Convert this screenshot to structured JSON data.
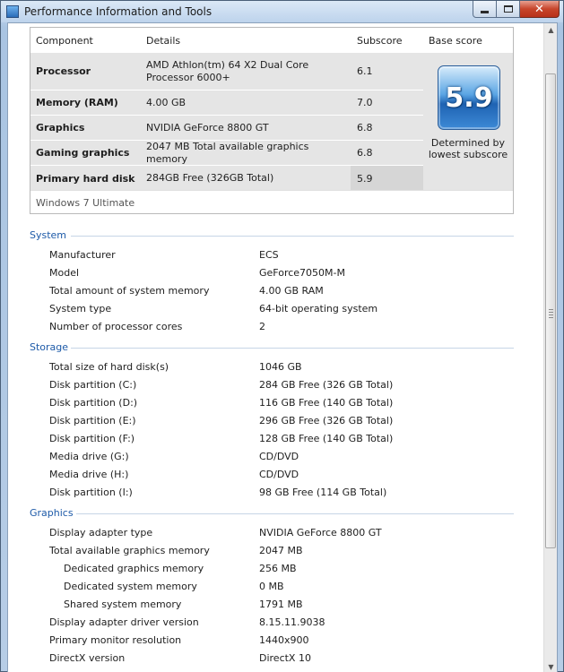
{
  "window": {
    "title": "Performance Information and Tools"
  },
  "scores": {
    "headers": {
      "component": "Component",
      "details": "Details",
      "subscore": "Subscore",
      "base": "Base score"
    },
    "rows": [
      {
        "component": "Processor",
        "details": "AMD Athlon(tm) 64 X2 Dual Core Processor 6000+",
        "subscore": "6.1"
      },
      {
        "component": "Memory (RAM)",
        "details": "4.00 GB",
        "subscore": "7.0"
      },
      {
        "component": "Graphics",
        "details": "NVIDIA GeForce 8800 GT",
        "subscore": "6.8"
      },
      {
        "component": "Gaming graphics",
        "details": "2047 MB Total available graphics memory",
        "subscore": "6.8"
      },
      {
        "component": "Primary hard disk",
        "details": "284GB Free (326GB Total)",
        "subscore": "5.9"
      }
    ],
    "base_score": "5.9",
    "base_caption_1": "Determined by",
    "base_caption_2": "lowest subscore",
    "edition": "Windows 7 Ultimate"
  },
  "system": {
    "title": "System",
    "items": [
      {
        "label": "Manufacturer",
        "value": "ECS"
      },
      {
        "label": "Model",
        "value": "GeForce7050M-M"
      },
      {
        "label": "Total amount of system memory",
        "value": "4.00 GB RAM"
      },
      {
        "label": "System type",
        "value": "64-bit operating system"
      },
      {
        "label": "Number of processor cores",
        "value": "2"
      }
    ]
  },
  "storage": {
    "title": "Storage",
    "items": [
      {
        "label": "Total size of hard disk(s)",
        "value": "1046 GB"
      },
      {
        "label": "Disk partition (C:)",
        "value": "284 GB Free (326 GB Total)"
      },
      {
        "label": "Disk partition (D:)",
        "value": "116 GB Free (140 GB Total)"
      },
      {
        "label": "Disk partition (E:)",
        "value": "296 GB Free (326 GB Total)"
      },
      {
        "label": "Disk partition (F:)",
        "value": "128 GB Free (140 GB Total)"
      },
      {
        "label": "Media drive (G:)",
        "value": "CD/DVD"
      },
      {
        "label": "Media drive (H:)",
        "value": "CD/DVD"
      },
      {
        "label": "Disk partition (I:)",
        "value": "98 GB Free (114 GB Total)"
      }
    ]
  },
  "graphics": {
    "title": "Graphics",
    "items": [
      {
        "label": "Display adapter type",
        "value": "NVIDIA GeForce 8800 GT"
      },
      {
        "label": "Total available graphics memory",
        "value": "2047 MB"
      },
      {
        "label": "Dedicated graphics memory",
        "value": "256 MB"
      },
      {
        "label": "Dedicated system memory",
        "value": "0 MB"
      },
      {
        "label": "Shared system memory",
        "value": "1791 MB"
      },
      {
        "label": "Display adapter driver version",
        "value": "8.15.11.9038"
      },
      {
        "label": "Primary monitor resolution",
        "value": "1440x900"
      },
      {
        "label": "DirectX version",
        "value": "DirectX 10"
      }
    ]
  },
  "colors": {
    "section_title": "#1d5aa8",
    "close_button": "#c7452b"
  }
}
